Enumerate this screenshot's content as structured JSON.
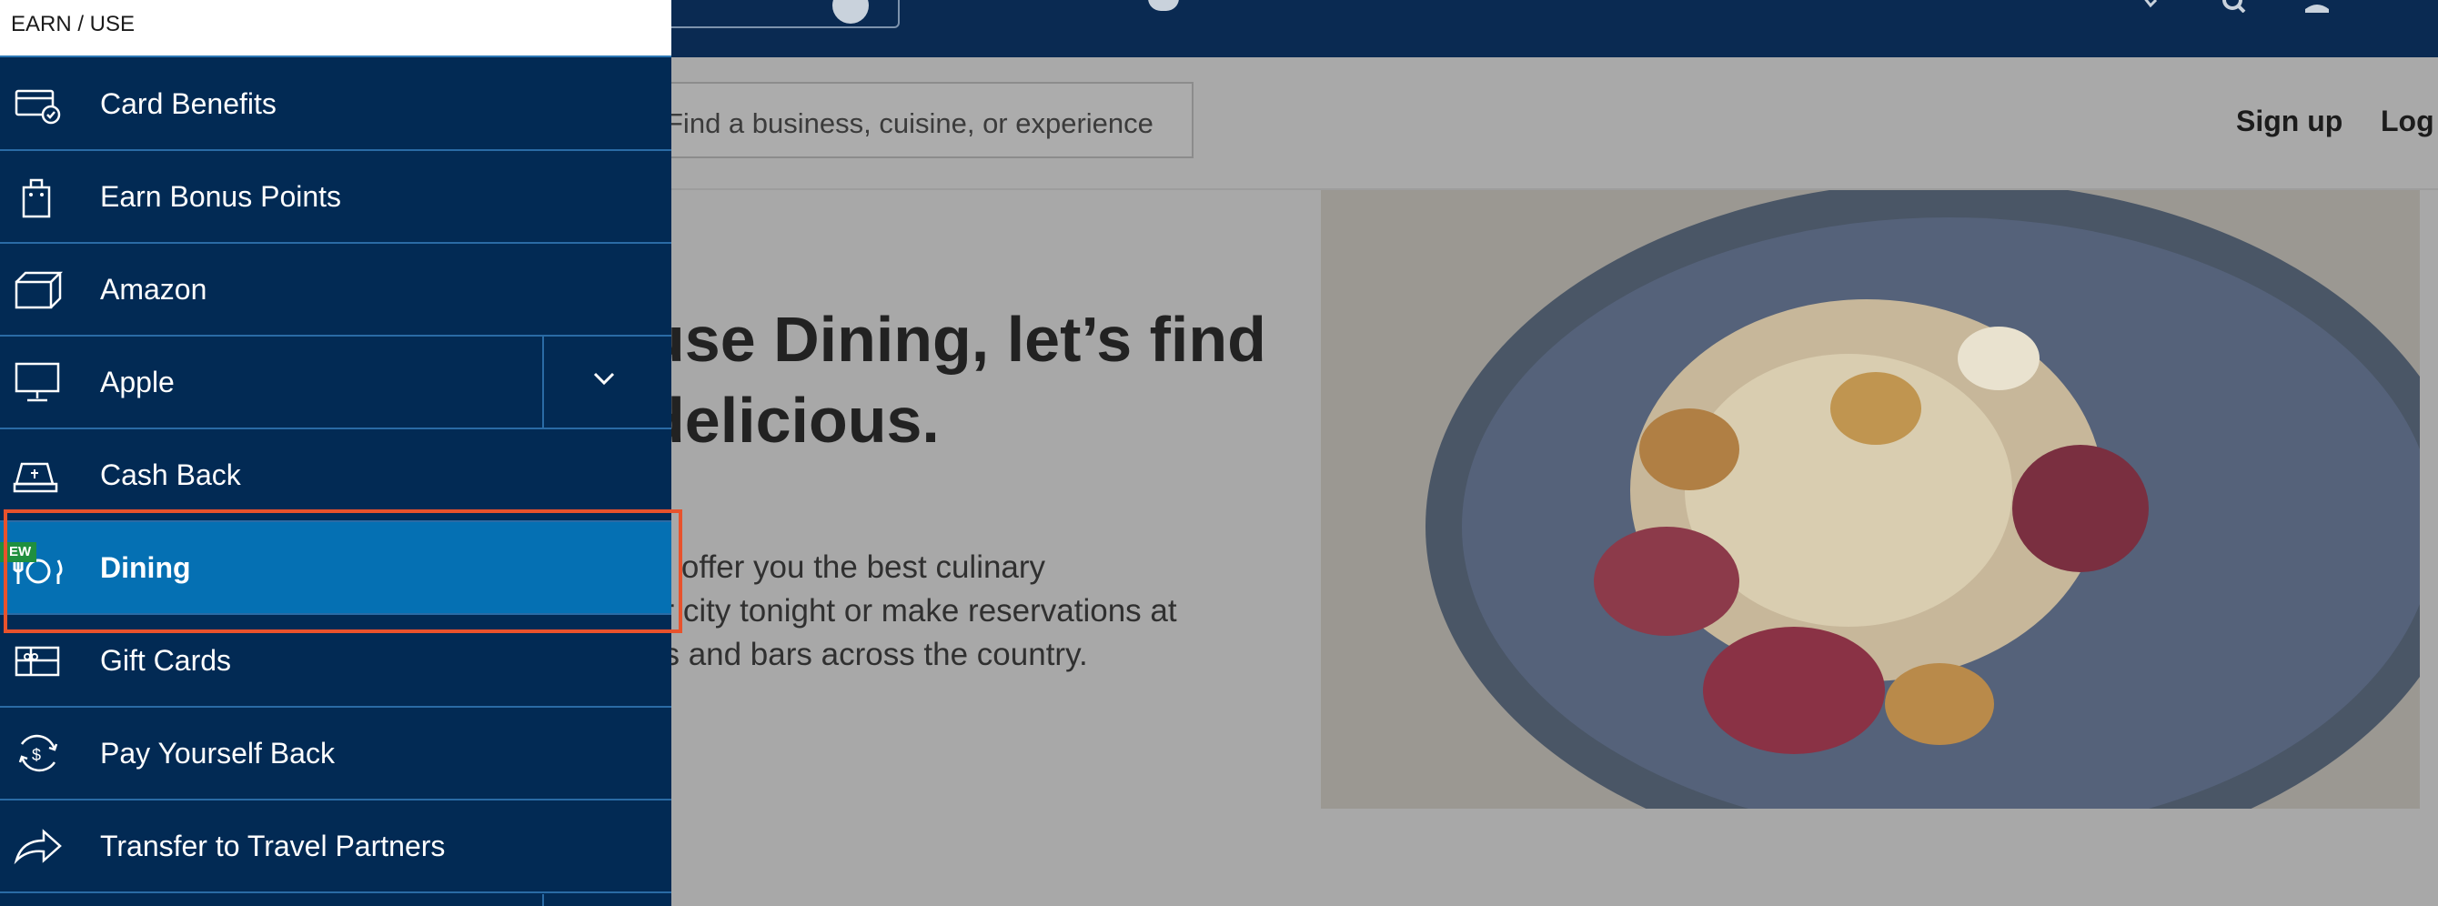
{
  "drawer": {
    "header": "EARN / USE",
    "items": [
      {
        "label": "Card Benefits",
        "icon": "card-check-icon"
      },
      {
        "label": "Earn Bonus Points",
        "icon": "shopping-bag-icon"
      },
      {
        "label": "Amazon",
        "icon": "box-icon"
      },
      {
        "label": "Apple",
        "icon": "monitor-icon",
        "expandable": true
      },
      {
        "label": "Cash Back",
        "icon": "cash-register-icon"
      },
      {
        "label": "Dining",
        "icon": "plate-cutlery-icon",
        "badge": "EW",
        "active": true
      },
      {
        "label": "Gift Cards",
        "icon": "gift-card-icon"
      },
      {
        "label": "Pay Yourself Back",
        "icon": "dollar-cycle-icon"
      },
      {
        "label": "Transfer to Travel Partners",
        "icon": "share-arrow-icon"
      }
    ]
  },
  "page": {
    "search_placeholder": "Find a business, cuisine, or experience",
    "signup": "Sign up",
    "login": "Log",
    "hero_title": "use Dining, let’s find\ndelicious.",
    "hero_body": "to offer you the best culinary\nur city tonight or make reservations at\nes and bars across the country."
  },
  "colors": {
    "drawer_bg": "#022a54",
    "active_bg": "#0570b3",
    "highlight": "#e8522c",
    "badge": "#1f8f3f"
  }
}
